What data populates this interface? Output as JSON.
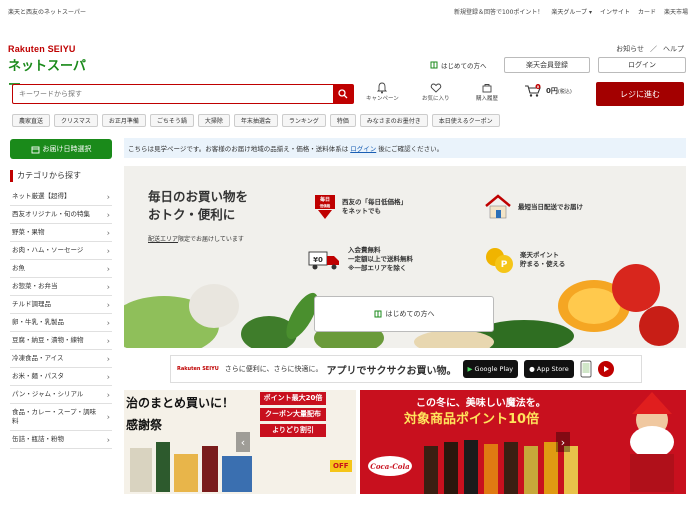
{
  "topbar": {
    "tagline": "楽天と西友のネットスーパー",
    "links": [
      "新規登録＆回答で100ポイント！",
      "楽天グループ ▾",
      "インサイト",
      "カード",
      "楽天市場"
    ]
  },
  "logo": {
    "brand_en": "Rakuten SEIYU",
    "brand_jp": "ネットスーパー"
  },
  "header": {
    "notice_link": "お知らせ",
    "help_link": "ヘルプ",
    "first_time_link": "はじめての方へ",
    "member_btn": "楽天会員登録",
    "login_btn": "ログイン"
  },
  "search": {
    "placeholder": "キーワードから探す",
    "icons": [
      {
        "label": "キャンペーン",
        "icon": "bell-icon"
      },
      {
        "label": "お気に入り",
        "icon": "heart-icon"
      },
      {
        "label": "購入履歴",
        "icon": "history-icon"
      }
    ],
    "cart_badge": "0",
    "cart_amount": "0",
    "cart_unit": "円",
    "cart_tax": "(税込)",
    "register_btn": "レジに進む"
  },
  "categories": [
    "農家直送",
    "クリスマス",
    "お正月準備",
    "ごちそう鍋",
    "大掃除",
    "年末抽選会",
    "ランキング",
    "特価",
    "みなさまのお墨付き",
    "本日使えるクーポン"
  ],
  "sidebar": {
    "delivery_btn": "お届け日時選択",
    "title": "カテゴリから探す",
    "items": [
      "ネット厳選【超得】",
      "西友オリジナル・旬の特集",
      "野菜・果物",
      "お肉・ハム・ソーセージ",
      "お魚",
      "お惣菜・お弁当",
      "チルド調理品",
      "卵・牛乳・乳製品",
      "豆腐・納豆・漬物・練物",
      "冷凍食品・アイス",
      "お米・麺・パスタ",
      "パン・ジャム・シリアル",
      "食品・カレー・スープ・調味料",
      "缶詰・瓶詰・粉物"
    ]
  },
  "notice": {
    "text_before": "こちらは見学ページです。お客様のお届け地域の品揃え・価格・送料体系は",
    "login_link": "ログイン",
    "text_after": "後にご確認ください。"
  },
  "hero": {
    "title_line1": "毎日のお買い物を",
    "title_line2": "おトク・便利に",
    "sub_link": "配送エリア",
    "sub_text": "限定でお届けしています",
    "features": [
      {
        "icon": "daily-price-icon",
        "badge1": "毎日",
        "badge2": "低価格",
        "line1": "西友の「毎日低価格」",
        "line2": "をネットでも"
      },
      {
        "icon": "house-icon",
        "line1": "最短当日配送でお届け",
        "line2": ""
      },
      {
        "icon": "truck-icon",
        "badge1": "¥0",
        "line1": "入会費無料",
        "line2": "一定額以上で送料無料",
        "line3": "※一部エリアを除く"
      },
      {
        "icon": "point-coin-icon",
        "badge1": "P",
        "line1": "楽天ポイント",
        "line2": "貯まる・使える"
      }
    ],
    "first_btn": "はじめての方へ"
  },
  "app_banner": {
    "logo": "Rakuten SEIYU",
    "text1": "さらに便利に、さらに快適に。",
    "text2": "アプリでサクサクお買い物。",
    "google_play": "Google Play",
    "app_store": "App Store"
  },
  "promo": {
    "left_line1": "治のまとめ買いに！",
    "left_line2": "感謝祭",
    "box1": "ポイント最大20倍",
    "box2": "クーポン大量配布",
    "box3": "よりどり割引",
    "off": "OFF",
    "right_line1": "この冬に、美味しい魔法を。",
    "right_line2": "対象商品ポイント10倍",
    "cola": "Coca-Cola"
  },
  "colors": {
    "brand_red": "#bf0000",
    "brand_green": "#1a8a1a",
    "register": "#a30000"
  }
}
